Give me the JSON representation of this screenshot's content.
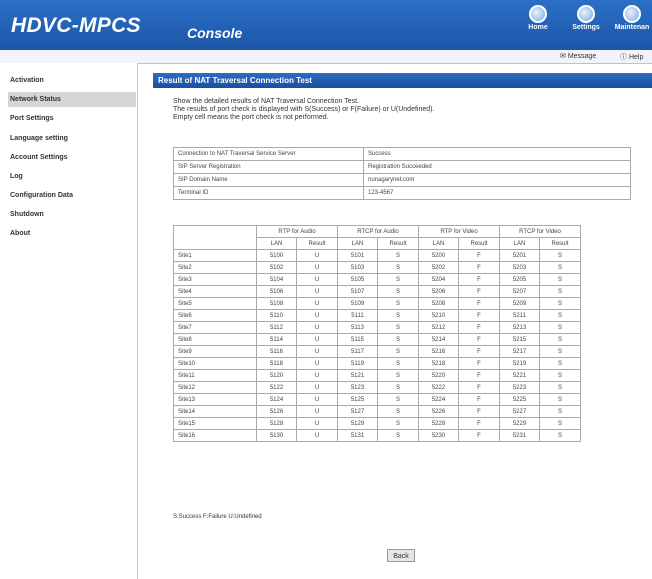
{
  "header": {
    "logo": "HDVC-MPCS",
    "console": "Console",
    "icons": [
      {
        "label": "Home",
        "icon": "home-icon"
      },
      {
        "label": "Settings",
        "icon": "settings-icon"
      },
      {
        "label": "Maintenan",
        "icon": "maintenance-icon"
      }
    ],
    "links": {
      "message": "Message",
      "help": "Help"
    }
  },
  "sidebar": {
    "items": [
      {
        "label": "Activation",
        "active": false
      },
      {
        "label": "Network Status",
        "active": true
      },
      {
        "label": "Port Settings",
        "active": false
      },
      {
        "label": "Language setting",
        "active": false
      },
      {
        "label": "Account Settings",
        "active": false
      },
      {
        "label": "Log",
        "active": false
      },
      {
        "label": "Configuration Data",
        "active": false
      },
      {
        "label": "Shutdown",
        "active": false
      },
      {
        "label": "About",
        "active": false
      }
    ]
  },
  "main": {
    "title": "Result of NAT Traversal Connection Test",
    "desc": [
      "Show the detailed results of NAT Traversal Connection Test.",
      "The results of port check is displayed with S(Success) or F(Failure) or U(Undefined).",
      "Empty cell means the port check is not performed."
    ],
    "kv": [
      {
        "key": "Connection to NAT Traversal Service Server",
        "value": "Success"
      },
      {
        "key": "SIP Server Registration",
        "value": "Registration Succeeded"
      },
      {
        "key": "SIP Domain Name",
        "value": "nunagarynet.com"
      },
      {
        "key": "Terminal ID",
        "value": "123-4567"
      }
    ],
    "groups": [
      "RTP for Audio",
      "RTCP for Audio",
      "RTP for Video",
      "RTCP for Video"
    ],
    "subheaders": [
      "LAN",
      "Result"
    ],
    "rows": [
      {
        "site": "Site1",
        "cells": [
          "5100",
          "U",
          "5101",
          "S",
          "5200",
          "F",
          "5201",
          "S"
        ]
      },
      {
        "site": "Site2",
        "cells": [
          "5102",
          "U",
          "5103",
          "S",
          "5202",
          "F",
          "5203",
          "S"
        ]
      },
      {
        "site": "Site3",
        "cells": [
          "5104",
          "U",
          "5105",
          "S",
          "5204",
          "F",
          "5205",
          "S"
        ]
      },
      {
        "site": "Site4",
        "cells": [
          "5106",
          "U",
          "5107",
          "S",
          "5206",
          "F",
          "5207",
          "S"
        ]
      },
      {
        "site": "Site5",
        "cells": [
          "5108",
          "U",
          "5109",
          "S",
          "5208",
          "F",
          "5209",
          "S"
        ]
      },
      {
        "site": "Site6",
        "cells": [
          "5110",
          "U",
          "5111",
          "S",
          "5210",
          "F",
          "5211",
          "S"
        ]
      },
      {
        "site": "Site7",
        "cells": [
          "5112",
          "U",
          "5113",
          "S",
          "5212",
          "F",
          "5213",
          "S"
        ]
      },
      {
        "site": "Site8",
        "cells": [
          "5114",
          "U",
          "5115",
          "S",
          "5214",
          "F",
          "5215",
          "S"
        ]
      },
      {
        "site": "Site9",
        "cells": [
          "5116",
          "U",
          "5117",
          "S",
          "5216",
          "F",
          "5217",
          "S"
        ]
      },
      {
        "site": "Site10",
        "cells": [
          "5118",
          "U",
          "5119",
          "S",
          "5218",
          "F",
          "5219",
          "S"
        ]
      },
      {
        "site": "Site11",
        "cells": [
          "5120",
          "U",
          "5121",
          "S",
          "5220",
          "F",
          "5221",
          "S"
        ]
      },
      {
        "site": "Site12",
        "cells": [
          "5122",
          "U",
          "5123",
          "S",
          "5222",
          "F",
          "5223",
          "S"
        ]
      },
      {
        "site": "Site13",
        "cells": [
          "5124",
          "U",
          "5125",
          "S",
          "5224",
          "F",
          "5225",
          "S"
        ]
      },
      {
        "site": "Site14",
        "cells": [
          "5126",
          "U",
          "5127",
          "S",
          "5226",
          "F",
          "5227",
          "S"
        ]
      },
      {
        "site": "Site15",
        "cells": [
          "5128",
          "U",
          "5129",
          "S",
          "5228",
          "F",
          "5229",
          "S"
        ]
      },
      {
        "site": "Site16",
        "cells": [
          "5130",
          "U",
          "5131",
          "S",
          "5230",
          "F",
          "5231",
          "S"
        ]
      }
    ],
    "legend": "S:Success   F:Failure   U:Undefined",
    "back": "Back"
  },
  "colors": {
    "header": "#1d56a8",
    "titlebar": "#2b6cc4",
    "active_nav": "#d6d6d6"
  }
}
